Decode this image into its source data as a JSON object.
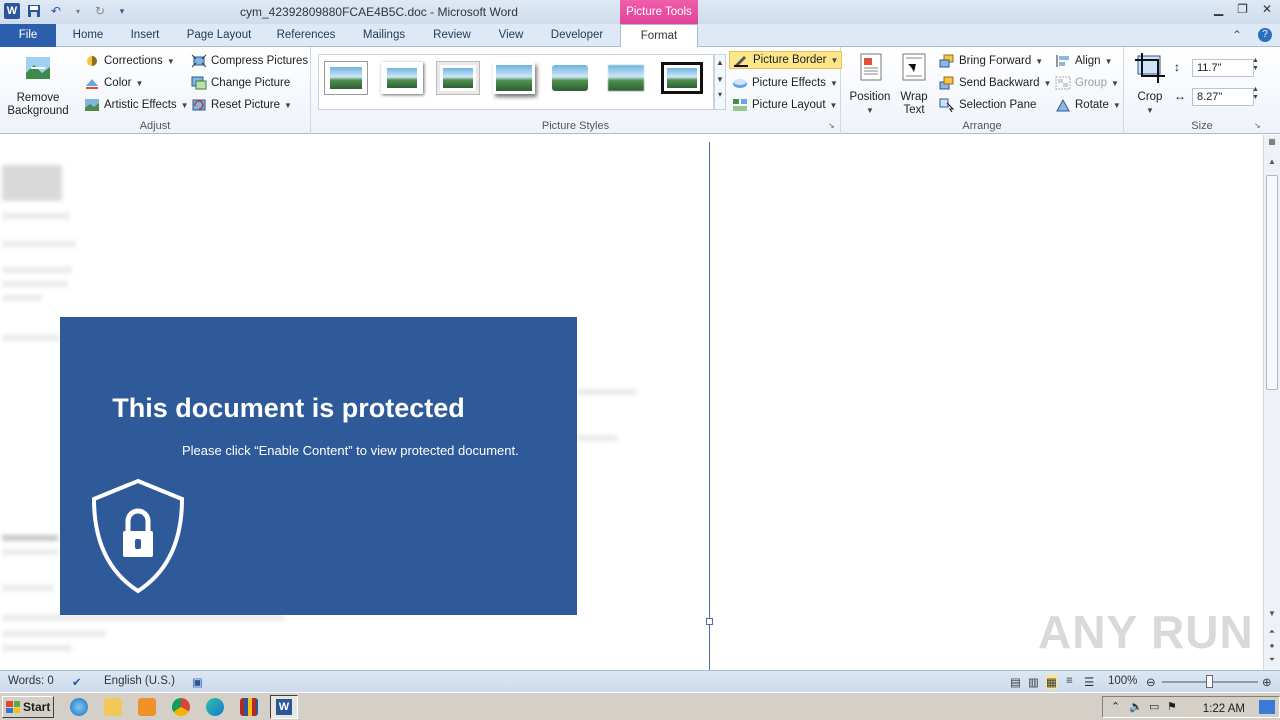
{
  "window": {
    "title": "cym_42392809880FCAE4B5C.doc - Microsoft Word",
    "context_tab": "Picture Tools",
    "controls": [
      "minimize",
      "restore",
      "close"
    ]
  },
  "tabs": {
    "file": "File",
    "items": [
      "Home",
      "Insert",
      "Page Layout",
      "References",
      "Mailings",
      "Review",
      "View",
      "Developer"
    ],
    "active": "Format"
  },
  "ribbon": {
    "adjust": {
      "label": "Adjust",
      "remove_background": "Remove Background",
      "corrections": "Corrections",
      "color": "Color",
      "artistic_effects": "Artistic Effects",
      "compress_pictures": "Compress Pictures",
      "change_picture": "Change Picture",
      "reset_picture": "Reset Picture"
    },
    "picture_styles": {
      "label": "Picture Styles",
      "picture_border": "Picture Border",
      "picture_effects": "Picture Effects",
      "picture_layout": "Picture Layout"
    },
    "arrange": {
      "label": "Arrange",
      "position": "Position",
      "wrap_text": "Wrap Text",
      "bring_forward": "Bring Forward",
      "send_backward": "Send Backward",
      "selection_pane": "Selection Pane",
      "align": "Align",
      "group": "Group",
      "rotate": "Rotate"
    },
    "size": {
      "label": "Size",
      "crop": "Crop",
      "height": "11.7\"",
      "width": "8.27\""
    }
  },
  "document": {
    "banner_title": "This document is protected",
    "banner_subtitle": "Please click “Enable Content” to view protected document.",
    "banner_color": "#2f5a9a",
    "watermark": "ANY RUN"
  },
  "status": {
    "words": "Words: 0",
    "language": "English (U.S.)",
    "zoom": "100%"
  },
  "taskbar": {
    "start": "Start",
    "clock": "1:22 AM"
  }
}
